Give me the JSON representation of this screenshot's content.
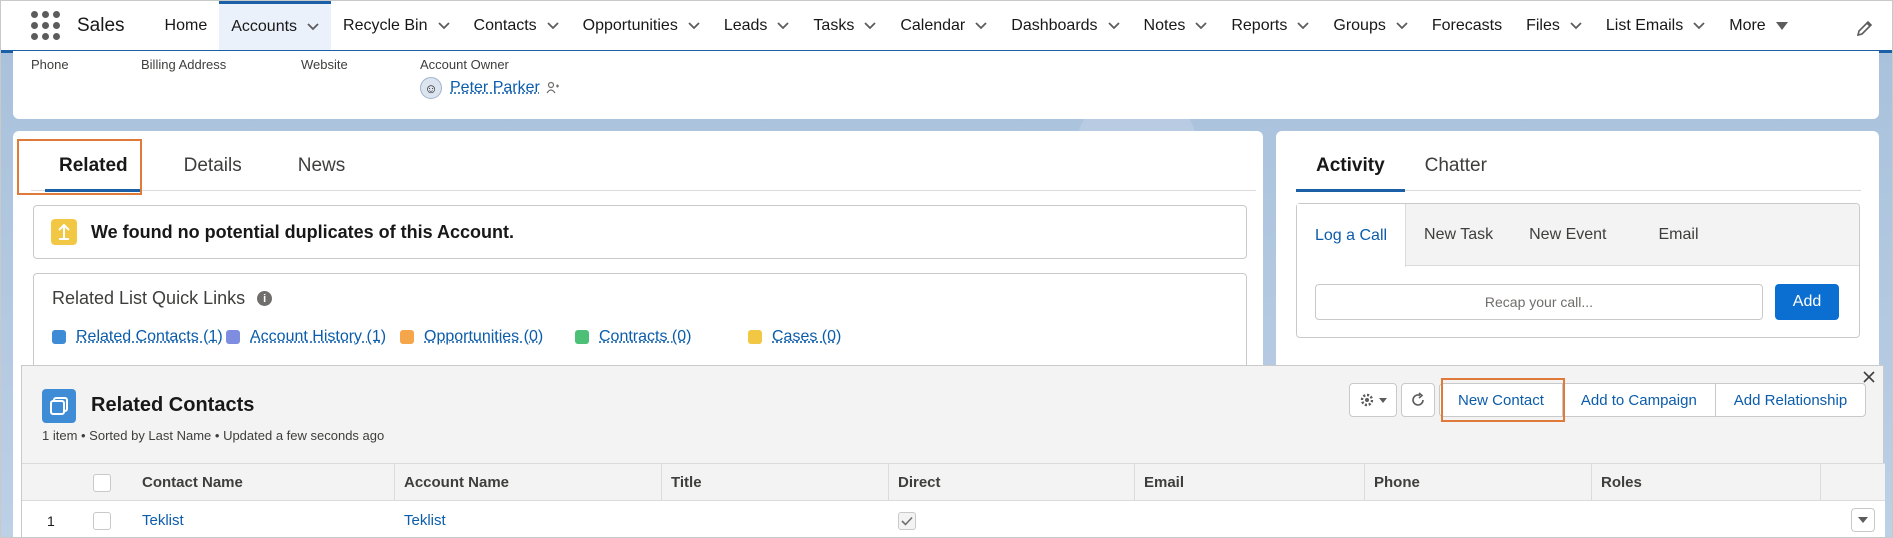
{
  "nav": {
    "app_name": "Sales",
    "items": [
      {
        "label": "Home",
        "chevron": false,
        "active": false
      },
      {
        "label": "Accounts",
        "chevron": true,
        "active": true
      },
      {
        "label": "Recycle Bin",
        "chevron": true,
        "active": false
      },
      {
        "label": "Contacts",
        "chevron": true,
        "active": false
      },
      {
        "label": "Opportunities",
        "chevron": true,
        "active": false
      },
      {
        "label": "Leads",
        "chevron": true,
        "active": false
      },
      {
        "label": "Tasks",
        "chevron": true,
        "active": false
      },
      {
        "label": "Calendar",
        "chevron": true,
        "active": false
      },
      {
        "label": "Dashboards",
        "chevron": true,
        "active": false
      },
      {
        "label": "Notes",
        "chevron": true,
        "active": false
      },
      {
        "label": "Reports",
        "chevron": true,
        "active": false
      },
      {
        "label": "Groups",
        "chevron": true,
        "active": false
      },
      {
        "label": "Forecasts",
        "chevron": false,
        "active": false
      },
      {
        "label": "Files",
        "chevron": true,
        "active": false
      },
      {
        "label": "List Emails",
        "chevron": true,
        "active": false
      }
    ],
    "more_label": "More",
    "accent_color": "#1b5fa6"
  },
  "highlights": {
    "fields": [
      "Phone",
      "Billing Address",
      "Website",
      "Account Owner"
    ],
    "owner_name": "Peter Parker"
  },
  "left_tabs": [
    "Related",
    "Details",
    "News"
  ],
  "duplicates_message": "We found no potential duplicates of this Account.",
  "quick_links": {
    "title": "Related List Quick Links",
    "items": [
      {
        "label": "Related Contacts (1)",
        "color": "#3f8cd6"
      },
      {
        "label": "Account History (1)",
        "color": "#7f8de1"
      },
      {
        "label": "Opportunities (0)",
        "color": "#f5a64b"
      },
      {
        "label": "Contracts (0)",
        "color": "#4bc076"
      },
      {
        "label": "Cases (0)",
        "color": "#f2c744"
      }
    ]
  },
  "right_tabs": [
    "Activity",
    "Chatter"
  ],
  "composer": {
    "tabs": [
      "Log a Call",
      "New Task",
      "New Event",
      "Email"
    ],
    "placeholder": "Recap your call...",
    "add_label": "Add"
  },
  "related_contacts": {
    "title": "Related Contacts",
    "subtitle": "1 item • Sorted by Last Name • Updated a few seconds ago",
    "buttons": [
      "New Contact",
      "Add to Campaign",
      "Add Relationship"
    ],
    "columns": [
      "Contact Name",
      "Account Name",
      "Title",
      "Direct",
      "Email",
      "Phone",
      "Roles"
    ],
    "rows": [
      {
        "num": "1",
        "contact": "Teklist",
        "account": "Teklist",
        "title": "",
        "direct": true,
        "email": "",
        "phone": "",
        "roles": ""
      }
    ]
  }
}
